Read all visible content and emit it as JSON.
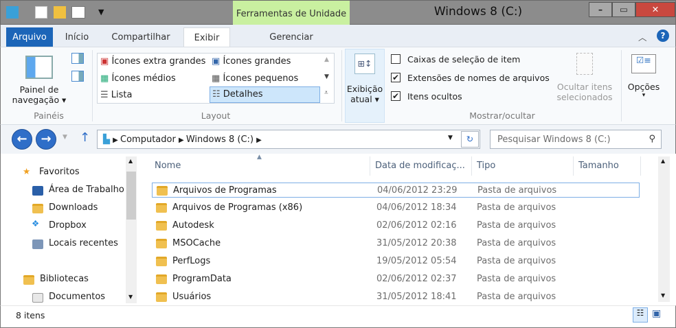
{
  "window": {
    "title": "Windows 8 (C:)",
    "contextual_tab": "Ferramentas de Unidade",
    "minimize": "–",
    "maximize": "▭",
    "close": "✕"
  },
  "tabs": [
    "Arquivo",
    "Início",
    "Compartilhar",
    "Exibir",
    "Gerenciar"
  ],
  "ribbon": {
    "panes": {
      "nav_pane": "Painel de",
      "nav_pane2": "navegação ▾",
      "group": "Painéis"
    },
    "layout": {
      "items": [
        "Ícones extra grandes",
        "Ícones grandes",
        "Ícones médios",
        "Ícones pequenos",
        "Lista",
        "Detalhes"
      ],
      "selected": "Detalhes",
      "group": "Layout"
    },
    "current_view": {
      "l1": "Exibição",
      "l2": "atual ▾"
    },
    "show_hide": {
      "checkboxes": [
        {
          "label": "Caixas de seleção de item",
          "checked": false
        },
        {
          "label": "Extensões de nomes de arquivos",
          "checked": true
        },
        {
          "label": "Itens ocultos",
          "checked": true
        }
      ],
      "hide_l1": "Ocultar itens",
      "hide_l2": "selecionados",
      "group": "Mostrar/ocultar"
    },
    "options": {
      "label": "Opções",
      "arrow": "▾"
    }
  },
  "address": {
    "crumbs": [
      "Computador",
      "Windows 8 (C:)"
    ],
    "search_placeholder": "Pesquisar Windows 8 (C:)"
  },
  "nav": {
    "favorites": "Favoritos",
    "fav_items": [
      "Área de Trabalho",
      "Downloads",
      "Dropbox",
      "Locais recentes"
    ],
    "libraries": "Bibliotecas",
    "lib_items": [
      "Documentos"
    ]
  },
  "columns": [
    "Nome",
    "Data de modificaç...",
    "Tipo",
    "Tamanho"
  ],
  "files": [
    {
      "name": "Arquivos de Programas",
      "date": "04/06/2012 23:29",
      "type": "Pasta de arquivos"
    },
    {
      "name": "Arquivos de Programas (x86)",
      "date": "04/06/2012 18:34",
      "type": "Pasta de arquivos"
    },
    {
      "name": "Autodesk",
      "date": "02/06/2012 02:16",
      "type": "Pasta de arquivos"
    },
    {
      "name": "MSOCache",
      "date": "31/05/2012 20:38",
      "type": "Pasta de arquivos"
    },
    {
      "name": "PerfLogs",
      "date": "19/05/2012 05:54",
      "type": "Pasta de arquivos"
    },
    {
      "name": "ProgramData",
      "date": "02/06/2012 02:37",
      "type": "Pasta de arquivos"
    },
    {
      "name": "Usuários",
      "date": "31/05/2012 18:41",
      "type": "Pasta de arquivos"
    }
  ],
  "status": {
    "count": "8 itens"
  }
}
